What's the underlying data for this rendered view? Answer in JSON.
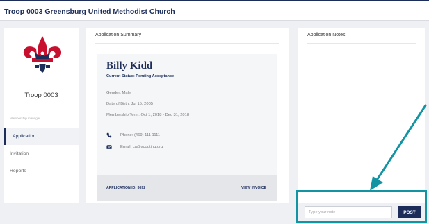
{
  "header": {
    "title": "Troop 0003 Greensburg United Methodist Church"
  },
  "sidebar": {
    "troop_name": "Troop 0003",
    "nav_caption": "Membership manager",
    "items": [
      {
        "label": "Application"
      },
      {
        "label": "Invitation"
      },
      {
        "label": "Reports"
      }
    ]
  },
  "summary": {
    "title": "Application Summary",
    "name": "Billy Kidd",
    "status": "Current Status:  Pending Acceptance",
    "gender": "Gender: Male",
    "dob": "Date of Birth: Jul 15, 2005",
    "term": "Membership Term: Oct 1, 2018 - Dec 31, 2018",
    "phone": "Phone:  (469) 111 1111",
    "email": "Email:  ca@scouting.org",
    "application_id": "APPLICATION ID: 3692",
    "view_invoice": "VIEW INVOICE"
  },
  "notes": {
    "title": "Application Notes",
    "placeholder": "Type your note",
    "post_label": "POST"
  },
  "colors": {
    "navy": "#1c2d5a",
    "accent": "#1394a3",
    "emblem_red": "#c8102e"
  },
  "icons": [
    "scouts-bsa-logo",
    "phone-icon",
    "mail-icon",
    "callout-arrow"
  ]
}
